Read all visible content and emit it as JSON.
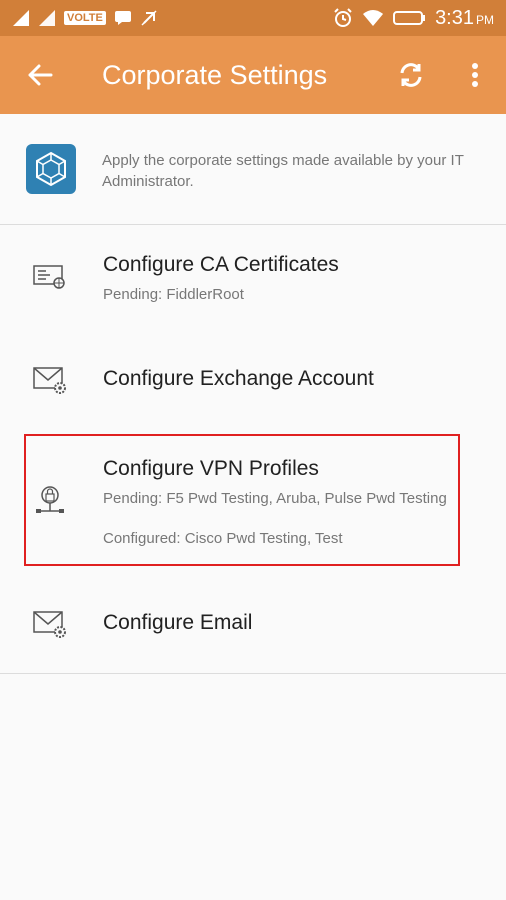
{
  "status_bar": {
    "network_badge": "VOLTE",
    "time": "3:31",
    "ampm": "PM"
  },
  "app_bar": {
    "title": "Corporate Settings",
    "icons": [
      "back-arrow-icon",
      "refresh-icon",
      "more-vertical-icon"
    ]
  },
  "intro": {
    "text": "Apply the corporate settings made available by your IT Administrator."
  },
  "items": [
    {
      "title": "Configure CA Certificates",
      "pending": "Pending: FiddlerRoot",
      "icon": "certificate-icon"
    },
    {
      "title": "Configure Exchange Account",
      "icon": "mail-settings-icon"
    },
    {
      "title": "Configure VPN Profiles",
      "pending": "Pending: F5 Pwd Testing, Aruba, Pulse Pwd Testing",
      "configured": "Configured: Cisco Pwd Testing, Test",
      "icon": "vpn-lock-icon"
    },
    {
      "title": "Configure Email",
      "icon": "mail-settings-icon"
    }
  ],
  "colors": {
    "status_bar": "#d17f39",
    "app_bar": "#e9954f",
    "highlight": "#e02020",
    "intro_icon_bg": "#2f81b3"
  }
}
